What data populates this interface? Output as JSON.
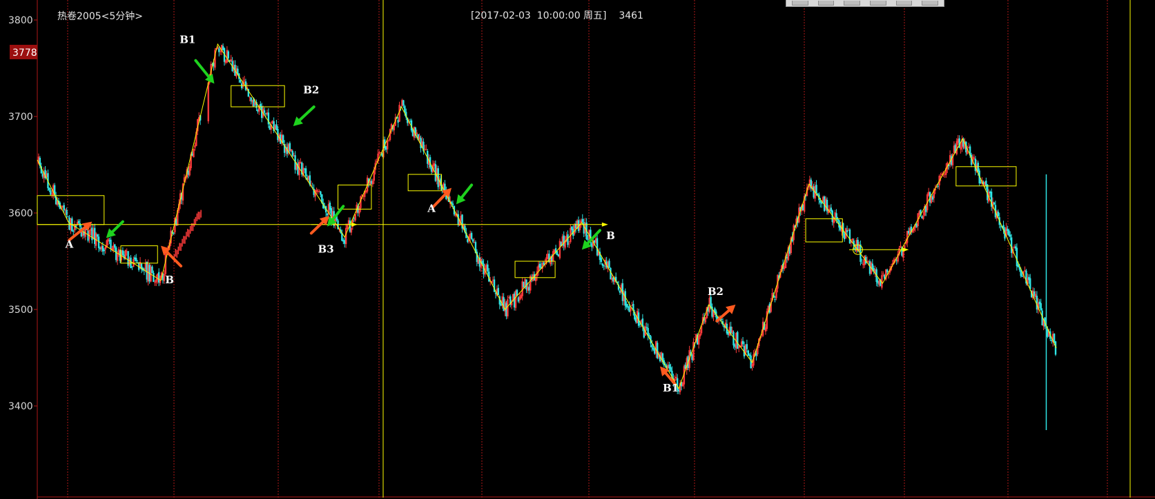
{
  "header": {
    "instrument": "热卷2005<5分钟>",
    "cursor_info": "[2017-02-03  10:00:00 周五]    3461"
  },
  "price_tag": "3778",
  "toolbar": {
    "button_count": 6
  },
  "colors": {
    "up": "#ff3b3b",
    "down": "#30e6e6",
    "zigzag": "#ffff00",
    "grid": "#b01818",
    "annot_green": "#1ed21e",
    "annot_orange": "#ff5a1f"
  },
  "chart_data": {
    "type": "candlestick",
    "ylim": [
      3340,
      3815
    ],
    "yticks": [
      3400,
      3500,
      3600,
      3700,
      3800
    ],
    "zigzag": [
      {
        "i": 0,
        "p": 3655
      },
      {
        "i": 47,
        "p": 3590
      },
      {
        "i": 185,
        "p": 3530
      },
      {
        "i": 270,
        "p": 3775
      },
      {
        "i": 460,
        "p": 3575
      },
      {
        "i": 545,
        "p": 3710
      },
      {
        "i": 700,
        "p": 3500
      },
      {
        "i": 815,
        "p": 3590
      },
      {
        "i": 960,
        "p": 3418
      },
      {
        "i": 1005,
        "p": 3505
      },
      {
        "i": 1070,
        "p": 3445
      },
      {
        "i": 1155,
        "p": 3630
      },
      {
        "i": 1265,
        "p": 3527
      },
      {
        "i": 1385,
        "p": 3677
      },
      {
        "i": 1525,
        "p": 3460
      }
    ],
    "boxes": [
      {
        "i0": 0,
        "i1": 100,
        "lo": 3588,
        "hi": 3618
      },
      {
        "i0": 125,
        "i1": 180,
        "lo": 3548,
        "hi": 3566
      },
      {
        "i0": 290,
        "i1": 370,
        "lo": 3710,
        "hi": 3732
      },
      {
        "i0": 450,
        "i1": 500,
        "lo": 3604,
        "hi": 3629
      },
      {
        "i0": 555,
        "i1": 605,
        "lo": 3623,
        "hi": 3640
      },
      {
        "i0": 715,
        "i1": 775,
        "lo": 3533,
        "hi": 3550
      },
      {
        "i0": 1150,
        "i1": 1205,
        "lo": 3570,
        "hi": 3594
      },
      {
        "i0": 1375,
        "i1": 1465,
        "lo": 3628,
        "hi": 3648
      }
    ],
    "hlines": [
      {
        "i0": 0,
        "i1": 470,
        "p": 3588
      },
      {
        "i0": 410,
        "i1": 845,
        "p": 3588
      },
      {
        "i0": 1215,
        "i1": 1295,
        "p": 3562
      }
    ],
    "labels": [
      {
        "text": "A",
        "i": 48,
        "p": 3564
      },
      {
        "text": "B",
        "i": 198,
        "p": 3527
      },
      {
        "text": "B1",
        "i": 225,
        "p": 3776
      },
      {
        "text": "B2",
        "i": 410,
        "p": 3724
      },
      {
        "text": "B3",
        "i": 432,
        "p": 3559
      },
      {
        "text": "A",
        "i": 590,
        "p": 3601
      },
      {
        "text": "B",
        "i": 858,
        "p": 3573
      },
      {
        "text": "B1",
        "i": 948,
        "p": 3415
      },
      {
        "text": "B2",
        "i": 1015,
        "p": 3515
      }
    ],
    "arrows": [
      {
        "color": "orange",
        "i0": 48,
        "p0": 3572,
        "i1": 82,
        "p1": 3591
      },
      {
        "color": "green",
        "i0": 128,
        "p0": 3591,
        "i1": 103,
        "p1": 3574
      },
      {
        "color": "orange",
        "i0": 215,
        "p0": 3545,
        "i1": 185,
        "p1": 3566
      },
      {
        "color": "green",
        "i0": 237,
        "p0": 3758,
        "i1": 265,
        "p1": 3734
      },
      {
        "color": "green",
        "i0": 414,
        "p0": 3710,
        "i1": 383,
        "p1": 3690
      },
      {
        "color": "orange",
        "i0": 410,
        "p0": 3579,
        "i1": 437,
        "p1": 3597
      },
      {
        "color": "green",
        "i0": 458,
        "p0": 3607,
        "i1": 434,
        "p1": 3586
      },
      {
        "color": "orange",
        "i0": 592,
        "p0": 3606,
        "i1": 620,
        "p1": 3626
      },
      {
        "color": "green",
        "i0": 650,
        "p0": 3629,
        "i1": 627,
        "p1": 3609
      },
      {
        "color": "green",
        "i0": 842,
        "p0": 3582,
        "i1": 815,
        "p1": 3562
      },
      {
        "color": "orange",
        "i0": 954,
        "p0": 3423,
        "i1": 932,
        "p1": 3441
      },
      {
        "color": "orange",
        "i0": 1017,
        "p0": 3488,
        "i1": 1045,
        "p1": 3505
      }
    ],
    "circle": {
      "i": 1228,
      "p": 3562
    }
  }
}
